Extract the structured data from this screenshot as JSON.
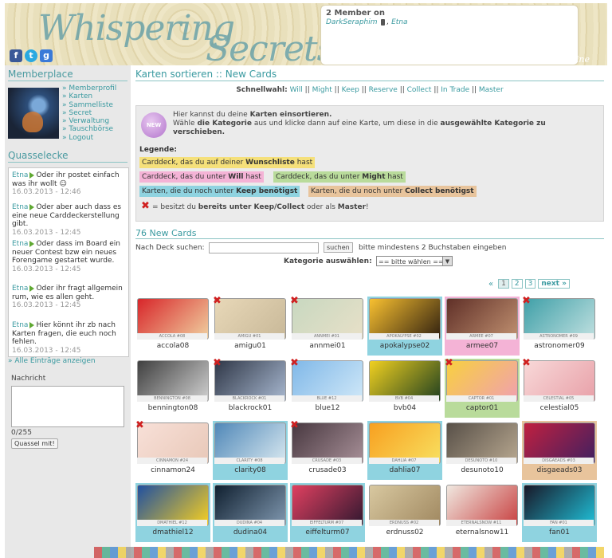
{
  "header": {
    "logo_line1": "Whispering",
    "logo_line2": "Secrets",
    "online_title": "2 Member on",
    "online_member1": "DarkSeraphim",
    "online_member2": "Etna",
    "whos_online": "Who's online"
  },
  "sidebar": {
    "memberplace_title": "Memberplace",
    "menu": [
      "» Memberprofil",
      "» Karten",
      "» Sammelliste",
      "» Secret",
      "» Verwaltung",
      "» Tauschbörse",
      "» Logout"
    ],
    "quasselecke_title": "Quasselecke",
    "shouts": [
      {
        "user": "Etna",
        "text": "Oder ihr postet einfach was ihr wollt",
        "time": "16.03.2013 - 12:46"
      },
      {
        "user": "Etna",
        "text": "Oder aber auch dass es eine neue Carddeckerstellung gibt.",
        "time": "16.03.2013 - 12:45"
      },
      {
        "user": "Etna",
        "text": "Oder dass im Board ein neuer Contest bzw ein neues Forengame gestartet wurde.",
        "time": "16.03.2013 - 12:45"
      },
      {
        "user": "Etna",
        "text": "Oder ihr fragt allgemein rum, wie es allen geht.",
        "time": "16.03.2013 - 12:45"
      },
      {
        "user": "Etna",
        "text": "Hier könnt ihr zb nach Karten fragen, die euch noch fehlen.",
        "time": "16.03.2013 - 12:45"
      }
    ],
    "all_entries": "» Alle Einträge anzeigen",
    "nachricht_label": "Nachricht",
    "counter": "0/255",
    "submit": "Quassel mit!"
  },
  "main": {
    "title": "Karten sortieren :: New Cards",
    "quick_label": "Schnellwahl:",
    "quick_items": [
      "Will",
      "Might",
      "Keep",
      "Reserve",
      "Collect",
      "In Trade",
      "Master"
    ],
    "badge": "NEW",
    "info_text_1": "Hier kannst du deine",
    "info_bold_1": "Karten einsortieren.",
    "info_text_2": "Wähle",
    "info_bold_2": "die Kategorie",
    "info_text_3": "aus und klicke dann auf eine Karte, um diese in die",
    "info_bold_3": "ausgewählte Kategorie zu verschieben.",
    "legend_title": "Legende:",
    "legend": {
      "wish_a": "Carddeck, das du auf deiner",
      "wish_b": "Wunschliste",
      "wish_c": "hast",
      "will_a": "Carddeck, das du unter",
      "will_b": "Will",
      "will_c": "hast",
      "might_a": "Carddeck, das du unter",
      "might_b": "Might",
      "might_c": "hast",
      "keep_a": "Karten, die du noch unter",
      "keep_b": "Keep benötigst",
      "collect_a": "Karten, die du noch unter",
      "collect_b": "Collect benötigst"
    },
    "x_text_1": "= besitzt du",
    "x_text_b": "bereits unter Keep/Collect",
    "x_text_2": "oder als",
    "x_text_b2": "Master",
    "x_text_3": "!",
    "new_cards_title": "76 New Cards",
    "search_label": "Nach Deck suchen:",
    "search_button": "suchen",
    "search_hint": "bitte mindestens 2 Buchstaben eingeben",
    "kategorie_label": "Kategorie auswählen:",
    "kategorie_value": "== bitte wählen ==",
    "pager": {
      "first": "«",
      "pages": [
        "1",
        "2",
        "3"
      ],
      "next": "next »"
    }
  },
  "cards": [
    {
      "name": "accola08",
      "strip": "ACCOLA #08",
      "x": false,
      "bg": "",
      "c1": "#d8262a",
      "c2": "#f0d0a0"
    },
    {
      "name": "amigu01",
      "strip": "AMIGU #01",
      "x": true,
      "bg": "",
      "c1": "#e8d8b8",
      "c2": "#c8b898"
    },
    {
      "name": "annmei01",
      "strip": "ANNMEI #01",
      "x": true,
      "bg": "",
      "c1": "#c8d8c0",
      "c2": "#e8e0c8"
    },
    {
      "name": "apokalypse02",
      "strip": "APOKALYPSE #02",
      "x": false,
      "bg": "keep",
      "c1": "#f8c030",
      "c2": "#302010"
    },
    {
      "name": "armee07",
      "strip": "ARMEE #07",
      "x": false,
      "bg": "will",
      "c1": "#603028",
      "c2": "#c09070"
    },
    {
      "name": "astronomer09",
      "strip": "ASTRONOMER #09",
      "x": true,
      "bg": "",
      "c1": "#40a0a8",
      "c2": "#c0e0e0"
    },
    {
      "name": "bennington08",
      "strip": "BENNINGTON #08",
      "x": false,
      "bg": "",
      "c1": "#404040",
      "c2": "#d0d0d0"
    },
    {
      "name": "blackrock01",
      "strip": "BLACKROCK #01",
      "x": true,
      "bg": "",
      "c1": "#303848",
      "c2": "#a8b8d0"
    },
    {
      "name": "blue12",
      "strip": "BLUE #12",
      "x": true,
      "bg": "",
      "c1": "#80b8e8",
      "c2": "#d0e8f8"
    },
    {
      "name": "bvb04",
      "strip": "BVB #04",
      "x": false,
      "bg": "",
      "c1": "#f0d020",
      "c2": "#204020"
    },
    {
      "name": "captor01",
      "strip": "CAPTOR #01",
      "x": true,
      "bg": "might",
      "c1": "#f8d040",
      "c2": "#f0a0b0"
    },
    {
      "name": "celestial05",
      "strip": "CELESTIAL #05",
      "x": true,
      "bg": "",
      "c1": "#f8d8d8",
      "c2": "#e8a0a8"
    },
    {
      "name": "cinnamon24",
      "strip": "CINNAMON #24",
      "x": true,
      "bg": "",
      "c1": "#f8e0d8",
      "c2": "#e8c8b8"
    },
    {
      "name": "clarity08",
      "strip": "CLARITY #08",
      "x": false,
      "bg": "keep",
      "c1": "#5088b8",
      "c2": "#d8e8f0"
    },
    {
      "name": "crusade03",
      "strip": "CRUSADE #03",
      "x": true,
      "bg": "",
      "c1": "#483840",
      "c2": "#a89098"
    },
    {
      "name": "dahlia07",
      "strip": "DAHLIA #07",
      "x": false,
      "bg": "keep",
      "c1": "#f8a020",
      "c2": "#f8e060"
    },
    {
      "name": "desunoto10",
      "strip": "DESUNOTO #10",
      "x": false,
      "bg": "",
      "c1": "#585048",
      "c2": "#b8a890"
    },
    {
      "name": "disgaeads03",
      "strip": "DISGAEADS #03",
      "x": false,
      "bg": "collect",
      "c1": "#c02040",
      "c2": "#402060"
    },
    {
      "name": "dmathiel12",
      "strip": "DMATHIEL #12",
      "x": false,
      "bg": "keep",
      "c1": "#2050a0",
      "c2": "#f8d020"
    },
    {
      "name": "dudina04",
      "strip": "DUDINA #04",
      "x": false,
      "bg": "keep",
      "c1": "#102030",
      "c2": "#8098b0"
    },
    {
      "name": "eiffelturm07",
      "strip": "EIFFELTURM #07",
      "x": false,
      "bg": "keep",
      "c1": "#e04060",
      "c2": "#301830"
    },
    {
      "name": "erdnuss02",
      "strip": "ERDNUSS #02",
      "x": false,
      "bg": "",
      "c1": "#d8c8a0",
      "c2": "#a08860"
    },
    {
      "name": "eternalsnow11",
      "strip": "ETERNALSNOW #11",
      "x": false,
      "bg": "",
      "c1": "#f0e8e0",
      "c2": "#c84040"
    },
    {
      "name": "fan01",
      "strip": "FAN #01",
      "x": false,
      "bg": "keep",
      "c1": "#181828",
      "c2": "#20c0d8"
    }
  ]
}
